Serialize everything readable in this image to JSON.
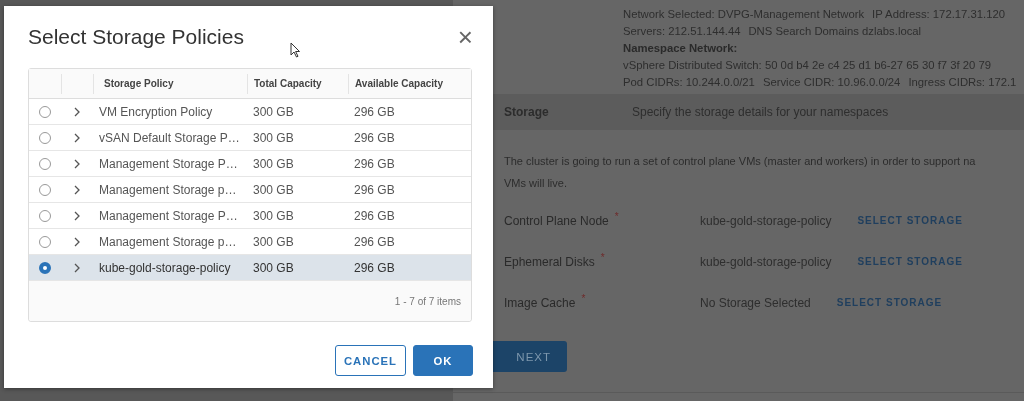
{
  "background": {
    "network_lines": [
      {
        "kind": "text",
        "parts": [
          "Network Selected: DVPG-Management Network",
          "IP Address: 172.17.31.120"
        ]
      },
      {
        "kind": "text",
        "parts": [
          "Servers: 212.51.144.44",
          "DNS Search Domains dzlabs.local"
        ]
      },
      {
        "kind": "heading",
        "parts": [
          "Namespace Network:"
        ]
      },
      {
        "kind": "text",
        "parts": [
          "vSphere Distributed Switch: 50 0d b4 2e c4 25 d1 b6-27 65 30 f7 3f 20 79"
        ]
      },
      {
        "kind": "text",
        "parts": [
          "Pod CIDRs: 10.244.0.0/21",
          "Service CIDR: 10.96.0.0/24",
          "Ingress CIDRs: 172.1"
        ]
      }
    ],
    "storage_step": {
      "title": "Storage",
      "description": "Specify the storage details for your namespaces"
    },
    "intro_lines": [
      "The cluster is going to run a set of control plane VMs (master and workers) in order to support na",
      "VMs will live."
    ],
    "fields": [
      {
        "label": "Control Plane Node",
        "required_mark": "*",
        "value": "kube-gold-storage-policy",
        "action": "SELECT STORAGE"
      },
      {
        "label": "Ephemeral Disks",
        "required_mark": "*",
        "value": "kube-gold-storage-policy",
        "action": "SELECT STORAGE"
      },
      {
        "label": "Image Cache",
        "required_mark": "*",
        "value": "No Storage Selected",
        "action": "SELECT STORAGE"
      }
    ],
    "next_button": "NEXT"
  },
  "dialog": {
    "title": "Select Storage Policies",
    "close": "×",
    "columns": [
      "Storage Policy",
      "Total Capacity",
      "Available Capacity"
    ],
    "rows": [
      {
        "policy": "VM Encryption Policy",
        "total": "300 GB",
        "available": "296 GB",
        "selected": false
      },
      {
        "policy": "vSAN Default Storage P…",
        "total": "300 GB",
        "available": "296 GB",
        "selected": false
      },
      {
        "policy": "Management Storage P…",
        "total": "300 GB",
        "available": "296 GB",
        "selected": false
      },
      {
        "policy": "Management Storage p…",
        "total": "300 GB",
        "available": "296 GB",
        "selected": false
      },
      {
        "policy": "Management Storage P…",
        "total": "300 GB",
        "available": "296 GB",
        "selected": false
      },
      {
        "policy": "Management Storage p…",
        "total": "300 GB",
        "available": "296 GB",
        "selected": false
      },
      {
        "policy": "kube-gold-storage-policy",
        "total": "300 GB",
        "available": "296 GB",
        "selected": true
      }
    ],
    "footer": "1 - 7 of 7 items",
    "buttons": [
      {
        "label": "CANCEL",
        "kind": "secondary"
      },
      {
        "label": "OK",
        "kind": "primary"
      }
    ]
  }
}
